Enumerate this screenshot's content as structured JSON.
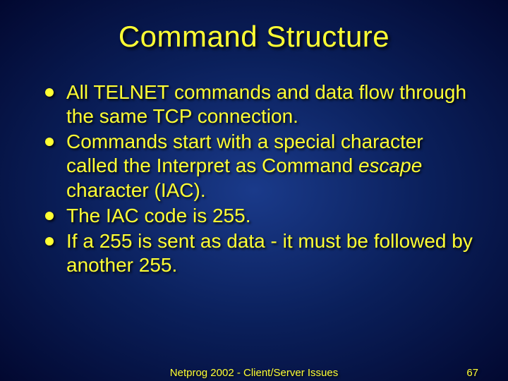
{
  "slide": {
    "title": "Command Structure",
    "bullets": [
      {
        "text": "All TELNET commands and data flow through the same TCP connection."
      },
      {
        "pre": "Commands start with a special character called the  Interpret as Command ",
        "em": "escape",
        "post": " character (IAC)."
      },
      {
        "text": "The IAC code is 255."
      },
      {
        "text": "If a 255 is sent as data - it must be followed by another 255."
      }
    ],
    "footer_center": "Netprog 2002 - Client/Server Issues",
    "footer_right": "67"
  }
}
